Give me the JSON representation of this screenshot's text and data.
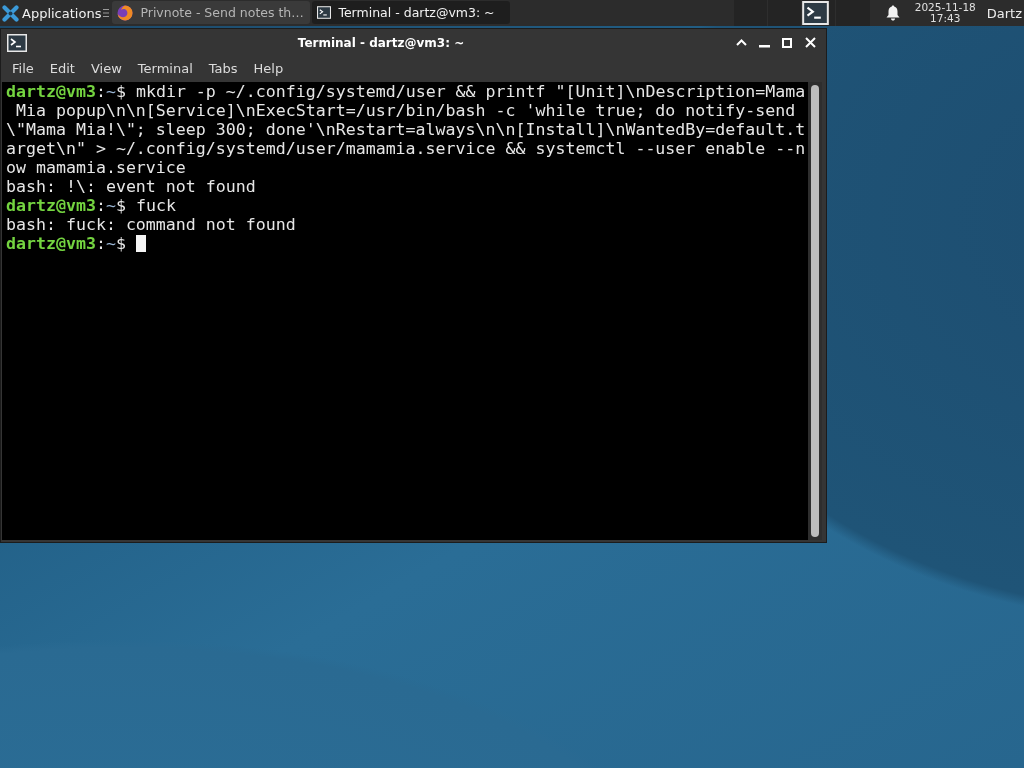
{
  "panel": {
    "applications_menu": {
      "label": "Applications"
    },
    "tasks": [
      {
        "kind": "browser",
        "label": "Privnote - Send notes th…",
        "selected": false
      },
      {
        "kind": "terminal",
        "label": "Terminal - dartz@vm3: ~",
        "selected": true
      }
    ],
    "clock": {
      "date": "2025-11-18",
      "time": "17:43"
    },
    "user": "Dartz"
  },
  "window": {
    "title": "Terminal - dartz@vm3: ~",
    "menu": [
      "File",
      "Edit",
      "View",
      "Terminal",
      "Tabs",
      "Help"
    ]
  },
  "terminal": {
    "lines": [
      {
        "kind": "prompt",
        "user": "dartz@vm3",
        "separator": ":",
        "cwd": "~",
        "sign": "$",
        "text": "mkdir -p ~/.config/systemd/user && printf \"[Unit]\\nDescription=Mama"
      },
      {
        "kind": "text",
        "text": " Mia popup\\n\\n[Service]\\nExecStart=/usr/bin/bash -c 'while true; do notify-send"
      },
      {
        "kind": "text",
        "text": "\\\"Mama Mia!\\\"; sleep 300; done'\\nRestart=always\\n\\n[Install]\\nWantedBy=default.t"
      },
      {
        "kind": "text",
        "text": "arget\\n\" > ~/.config/systemd/user/mamamia.service && systemctl --user enable --n"
      },
      {
        "kind": "text",
        "text": "ow mamamia.service"
      },
      {
        "kind": "text",
        "text": "bash: !\\: event not found"
      },
      {
        "kind": "prompt",
        "user": "dartz@vm3",
        "separator": ":",
        "cwd": "~",
        "sign": "$",
        "text": "fuck"
      },
      {
        "kind": "text",
        "text": "bash: fuck: command not found"
      },
      {
        "kind": "prompt",
        "user": "dartz@vm3",
        "separator": ":",
        "cwd": "~",
        "sign": "$",
        "cursor": true
      }
    ]
  }
}
